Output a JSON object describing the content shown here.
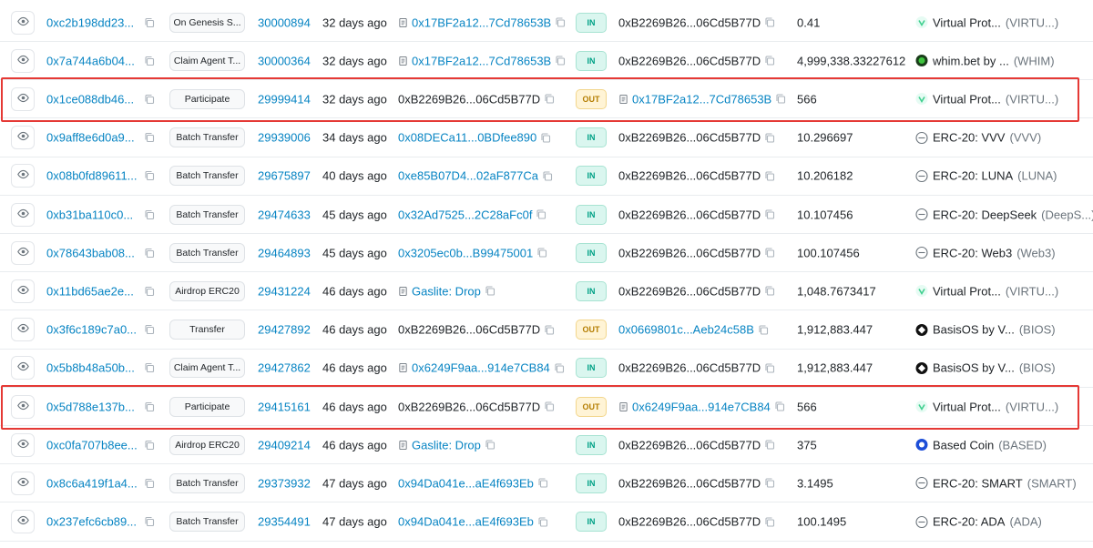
{
  "columns_hidden": true,
  "rows": [
    {
      "hash": "0xc2b198dd23...",
      "method": "On Genesis S...",
      "block": "30000894",
      "age": "32 days ago",
      "from": "0x17BF2a12...7Cd78653B",
      "from_icon": "doc-icon",
      "from_link": true,
      "direction": "IN",
      "to": "0xB2269B26...06Cd5B77D",
      "to_icon": "",
      "to_link": false,
      "amount": "0.41",
      "token_name": "Virtual Prot...",
      "token_symbol": "(VIRTU...)",
      "token_icon": "virtual-protocol-icon"
    },
    {
      "hash": "0x7a744a6b04...",
      "method": "Claim Agent T...",
      "block": "30000364",
      "age": "32 days ago",
      "from": "0x17BF2a12...7Cd78653B",
      "from_icon": "doc-icon",
      "from_link": true,
      "direction": "IN",
      "to": "0xB2269B26...06Cd5B77D",
      "to_icon": "",
      "to_link": false,
      "amount": "4,999,338.33227612",
      "token_name": "whim.bet by ...",
      "token_symbol": "(WHIM)",
      "token_icon": "whim-icon"
    },
    {
      "hash": "0x1ce088db46...",
      "method": "Participate",
      "block": "29999414",
      "age": "32 days ago",
      "from": "0xB2269B26...06Cd5B77D",
      "from_icon": "",
      "from_link": false,
      "direction": "OUT",
      "to": "0x17BF2a12...7Cd78653B",
      "to_icon": "doc-icon",
      "to_link": true,
      "amount": "566",
      "token_name": "Virtual Prot...",
      "token_symbol": "(VIRTU...)",
      "token_icon": "virtual-protocol-icon"
    },
    {
      "hash": "0x9aff8e6d0a9...",
      "method": "Batch Transfer",
      "block": "29939006",
      "age": "34 days ago",
      "from": "0x08DECa11...0BDfee890",
      "from_icon": "",
      "from_link": true,
      "direction": "IN",
      "to": "0xB2269B26...06Cd5B77D",
      "to_icon": "",
      "to_link": false,
      "amount": "10.296697",
      "token_name": "ERC-20: VVV",
      "token_symbol": "(VVV)",
      "token_icon": "erc20-icon"
    },
    {
      "hash": "0x08b0fd89611...",
      "method": "Batch Transfer",
      "block": "29675897",
      "age": "40 days ago",
      "from": "0xe85B07D4...02aF877Ca",
      "from_icon": "",
      "from_link": true,
      "direction": "IN",
      "to": "0xB2269B26...06Cd5B77D",
      "to_icon": "",
      "to_link": false,
      "amount": "10.206182",
      "token_name": "ERC-20: LUNA",
      "token_symbol": "(LUNA)",
      "token_icon": "erc20-icon"
    },
    {
      "hash": "0xb31ba110c0...",
      "method": "Batch Transfer",
      "block": "29474633",
      "age": "45 days ago",
      "from": "0x32Ad7525...2C28aFc0f",
      "from_icon": "",
      "from_link": true,
      "direction": "IN",
      "to": "0xB2269B26...06Cd5B77D",
      "to_icon": "",
      "to_link": false,
      "amount": "10.107456",
      "token_name": "ERC-20: DeepSeek",
      "token_symbol": "(DeepS...)",
      "token_icon": "erc20-icon"
    },
    {
      "hash": "0x78643bab08...",
      "method": "Batch Transfer",
      "block": "29464893",
      "age": "45 days ago",
      "from": "0x3205ec0b...B99475001",
      "from_icon": "",
      "from_link": true,
      "direction": "IN",
      "to": "0xB2269B26...06Cd5B77D",
      "to_icon": "",
      "to_link": false,
      "amount": "100.107456",
      "token_name": "ERC-20: Web3",
      "token_symbol": "(Web3)",
      "token_icon": "erc20-icon"
    },
    {
      "hash": "0x11bd65ae2e...",
      "method": "Airdrop ERC20",
      "block": "29431224",
      "age": "46 days ago",
      "from": "Gaslite: Drop",
      "from_icon": "doc-icon",
      "from_link": true,
      "direction": "IN",
      "to": "0xB2269B26...06Cd5B77D",
      "to_icon": "",
      "to_link": false,
      "amount": "1,048.7673417",
      "token_name": "Virtual Prot...",
      "token_symbol": "(VIRTU...)",
      "token_icon": "virtual-protocol-icon"
    },
    {
      "hash": "0x3f6c189c7a0...",
      "method": "Transfer",
      "block": "29427892",
      "age": "46 days ago",
      "from": "0xB2269B26...06Cd5B77D",
      "from_icon": "",
      "from_link": false,
      "direction": "OUT",
      "to": "0x0669801c...Aeb24c58B",
      "to_icon": "",
      "to_link": true,
      "amount": "1,912,883.447",
      "token_name": "BasisOS by V...",
      "token_symbol": "(BIOS)",
      "token_icon": "basisos-icon"
    },
    {
      "hash": "0x5b8b48a50b...",
      "method": "Claim Agent T...",
      "block": "29427862",
      "age": "46 days ago",
      "from": "0x6249F9aa...914e7CB84",
      "from_icon": "doc-icon",
      "from_link": true,
      "direction": "IN",
      "to": "0xB2269B26...06Cd5B77D",
      "to_icon": "",
      "to_link": false,
      "amount": "1,912,883.447",
      "token_name": "BasisOS by V...",
      "token_symbol": "(BIOS)",
      "token_icon": "basisos-icon"
    },
    {
      "hash": "0x5d788e137b...",
      "method": "Participate",
      "block": "29415161",
      "age": "46 days ago",
      "from": "0xB2269B26...06Cd5B77D",
      "from_icon": "",
      "from_link": false,
      "direction": "OUT",
      "to": "0x6249F9aa...914e7CB84",
      "to_icon": "doc-icon",
      "to_link": true,
      "amount": "566",
      "token_name": "Virtual Prot...",
      "token_symbol": "(VIRTU...)",
      "token_icon": "virtual-protocol-icon"
    },
    {
      "hash": "0xc0fa707b8ee...",
      "method": "Airdrop ERC20",
      "block": "29409214",
      "age": "46 days ago",
      "from": "Gaslite: Drop",
      "from_icon": "doc-icon",
      "from_link": true,
      "direction": "IN",
      "to": "0xB2269B26...06Cd5B77D",
      "to_icon": "",
      "to_link": false,
      "amount": "375",
      "token_name": "Based Coin",
      "token_symbol": "(BASED)",
      "token_icon": "based-coin-icon"
    },
    {
      "hash": "0x8c6a419f1a4...",
      "method": "Batch Transfer",
      "block": "29373932",
      "age": "47 days ago",
      "from": "0x94Da041e...aE4f693Eb",
      "from_icon": "",
      "from_link": true,
      "direction": "IN",
      "to": "0xB2269B26...06Cd5B77D",
      "to_icon": "",
      "to_link": false,
      "amount": "3.1495",
      "token_name": "ERC-20: SMART",
      "token_symbol": "(SMART)",
      "token_icon": "erc20-icon"
    },
    {
      "hash": "0x237efc6cb89...",
      "method": "Batch Transfer",
      "block": "29354491",
      "age": "47 days ago",
      "from": "0x94Da041e...aE4f693Eb",
      "from_icon": "",
      "from_link": true,
      "direction": "IN",
      "to": "0xB2269B26...06Cd5B77D",
      "to_icon": "",
      "to_link": false,
      "amount": "100.1495",
      "token_name": "ERC-20: ADA",
      "token_symbol": "(ADA)",
      "token_icon": "erc20-icon"
    }
  ],
  "highlighted_rows": [
    2,
    10
  ],
  "colors": {
    "link": "#0784c3",
    "in_badge": "#00a186",
    "out_badge": "#b47d00",
    "highlight": "#e53935"
  }
}
